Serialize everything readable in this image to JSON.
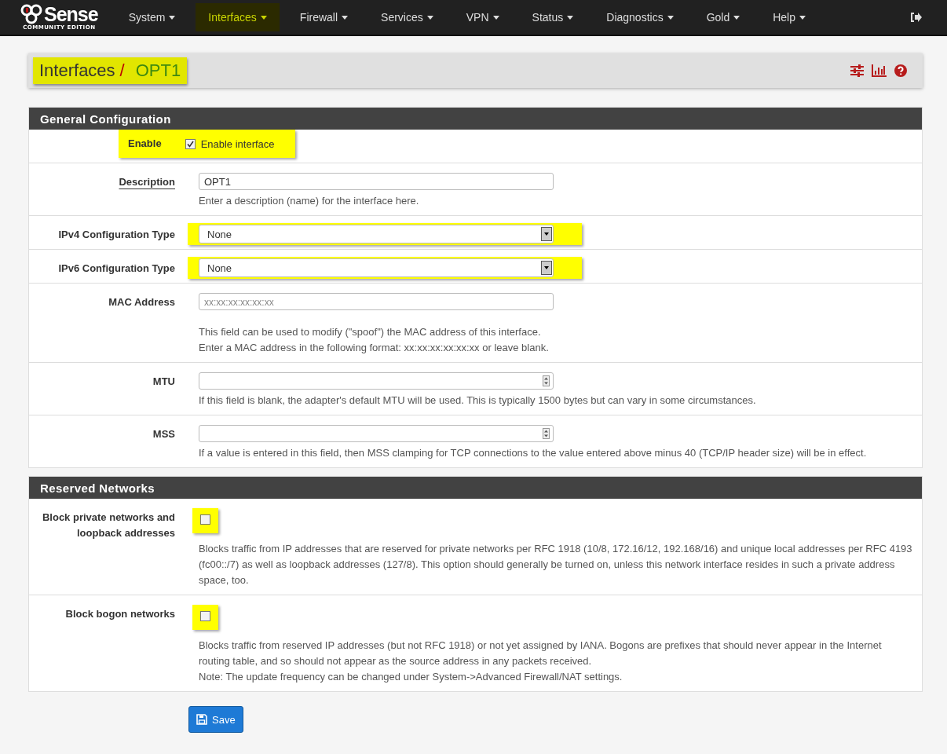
{
  "navbar": {
    "logo_text": "Sense",
    "logo_subtext": "COMMUNITY EDITION",
    "menus": [
      {
        "label": "System",
        "selected": false
      },
      {
        "label": "Interfaces",
        "selected": true
      },
      {
        "label": "Firewall",
        "selected": false
      },
      {
        "label": "Services",
        "selected": false
      },
      {
        "label": "VPN",
        "selected": false
      },
      {
        "label": "Status",
        "selected": false
      },
      {
        "label": "Diagnostics",
        "selected": false
      },
      {
        "label": "Gold",
        "selected": false
      },
      {
        "label": "Help",
        "selected": false
      }
    ]
  },
  "breadcrumb": {
    "parent": "Interfaces",
    "separator": "/",
    "current": "OPT1",
    "highlighted": true
  },
  "panels": [
    {
      "title": "General Configuration",
      "rows": [
        {
          "kind": "checkbox",
          "label": "Enable",
          "checked": true,
          "checkbox_label": "Enable interface",
          "highlighted": true
        },
        {
          "kind": "text",
          "label": "Description",
          "required": true,
          "value": "OPT1",
          "help": [
            "Enter a description (name) for the interface here."
          ]
        },
        {
          "kind": "select",
          "label": "IPv4 Configuration Type",
          "value": "None",
          "highlighted": true
        },
        {
          "kind": "select",
          "label": "IPv6 Configuration Type",
          "value": "None",
          "highlighted": true
        },
        {
          "kind": "text",
          "label": "MAC Address",
          "required": false,
          "placeholder": "xx:xx:xx:xx:xx:xx",
          "help": [
            "This field can be used to modify (\"spoof\") the MAC address of this interface.",
            "Enter a MAC address in the following format: xx:xx:xx:xx:xx:xx or leave blank."
          ]
        },
        {
          "kind": "number",
          "label": "MTU",
          "help": [
            "If this field is blank, the adapter's default MTU will be used. This is typically 1500 bytes but can vary in some circumstances."
          ]
        },
        {
          "kind": "number",
          "label": "MSS",
          "help": [
            "If a value is entered in this field, then MSS clamping for TCP connections to the value entered above minus 40 (TCP/IP header size) will be in effect."
          ]
        }
      ]
    },
    {
      "title": "Reserved Networks",
      "rows": [
        {
          "kind": "checkbox",
          "label": "Block private networks and loopback addresses",
          "checked": false,
          "highlighted": true,
          "help": [
            "Blocks traffic from IP addresses that are reserved for private networks per RFC 1918 (10/8, 172.16/12, 192.168/16) and unique local addresses per RFC 4193 (fc00::/7) as well as loopback addresses (127/8). This option should generally be turned on, unless this network interface resides in such a private address space, too."
          ]
        },
        {
          "kind": "checkbox",
          "label": "Block bogon networks",
          "checked": false,
          "highlighted": true,
          "help": [
            "Blocks traffic from reserved IP addresses (but not RFC 1918) or not yet assigned by IANA. Bogons are prefixes that should never appear in the Internet routing table, and so should not appear as the source address in any packets received.",
            "Note: The update frequency can be changed under System->Advanced Firewall/NAT settings."
          ]
        }
      ]
    }
  ],
  "save_button": {
    "label": "Save"
  }
}
